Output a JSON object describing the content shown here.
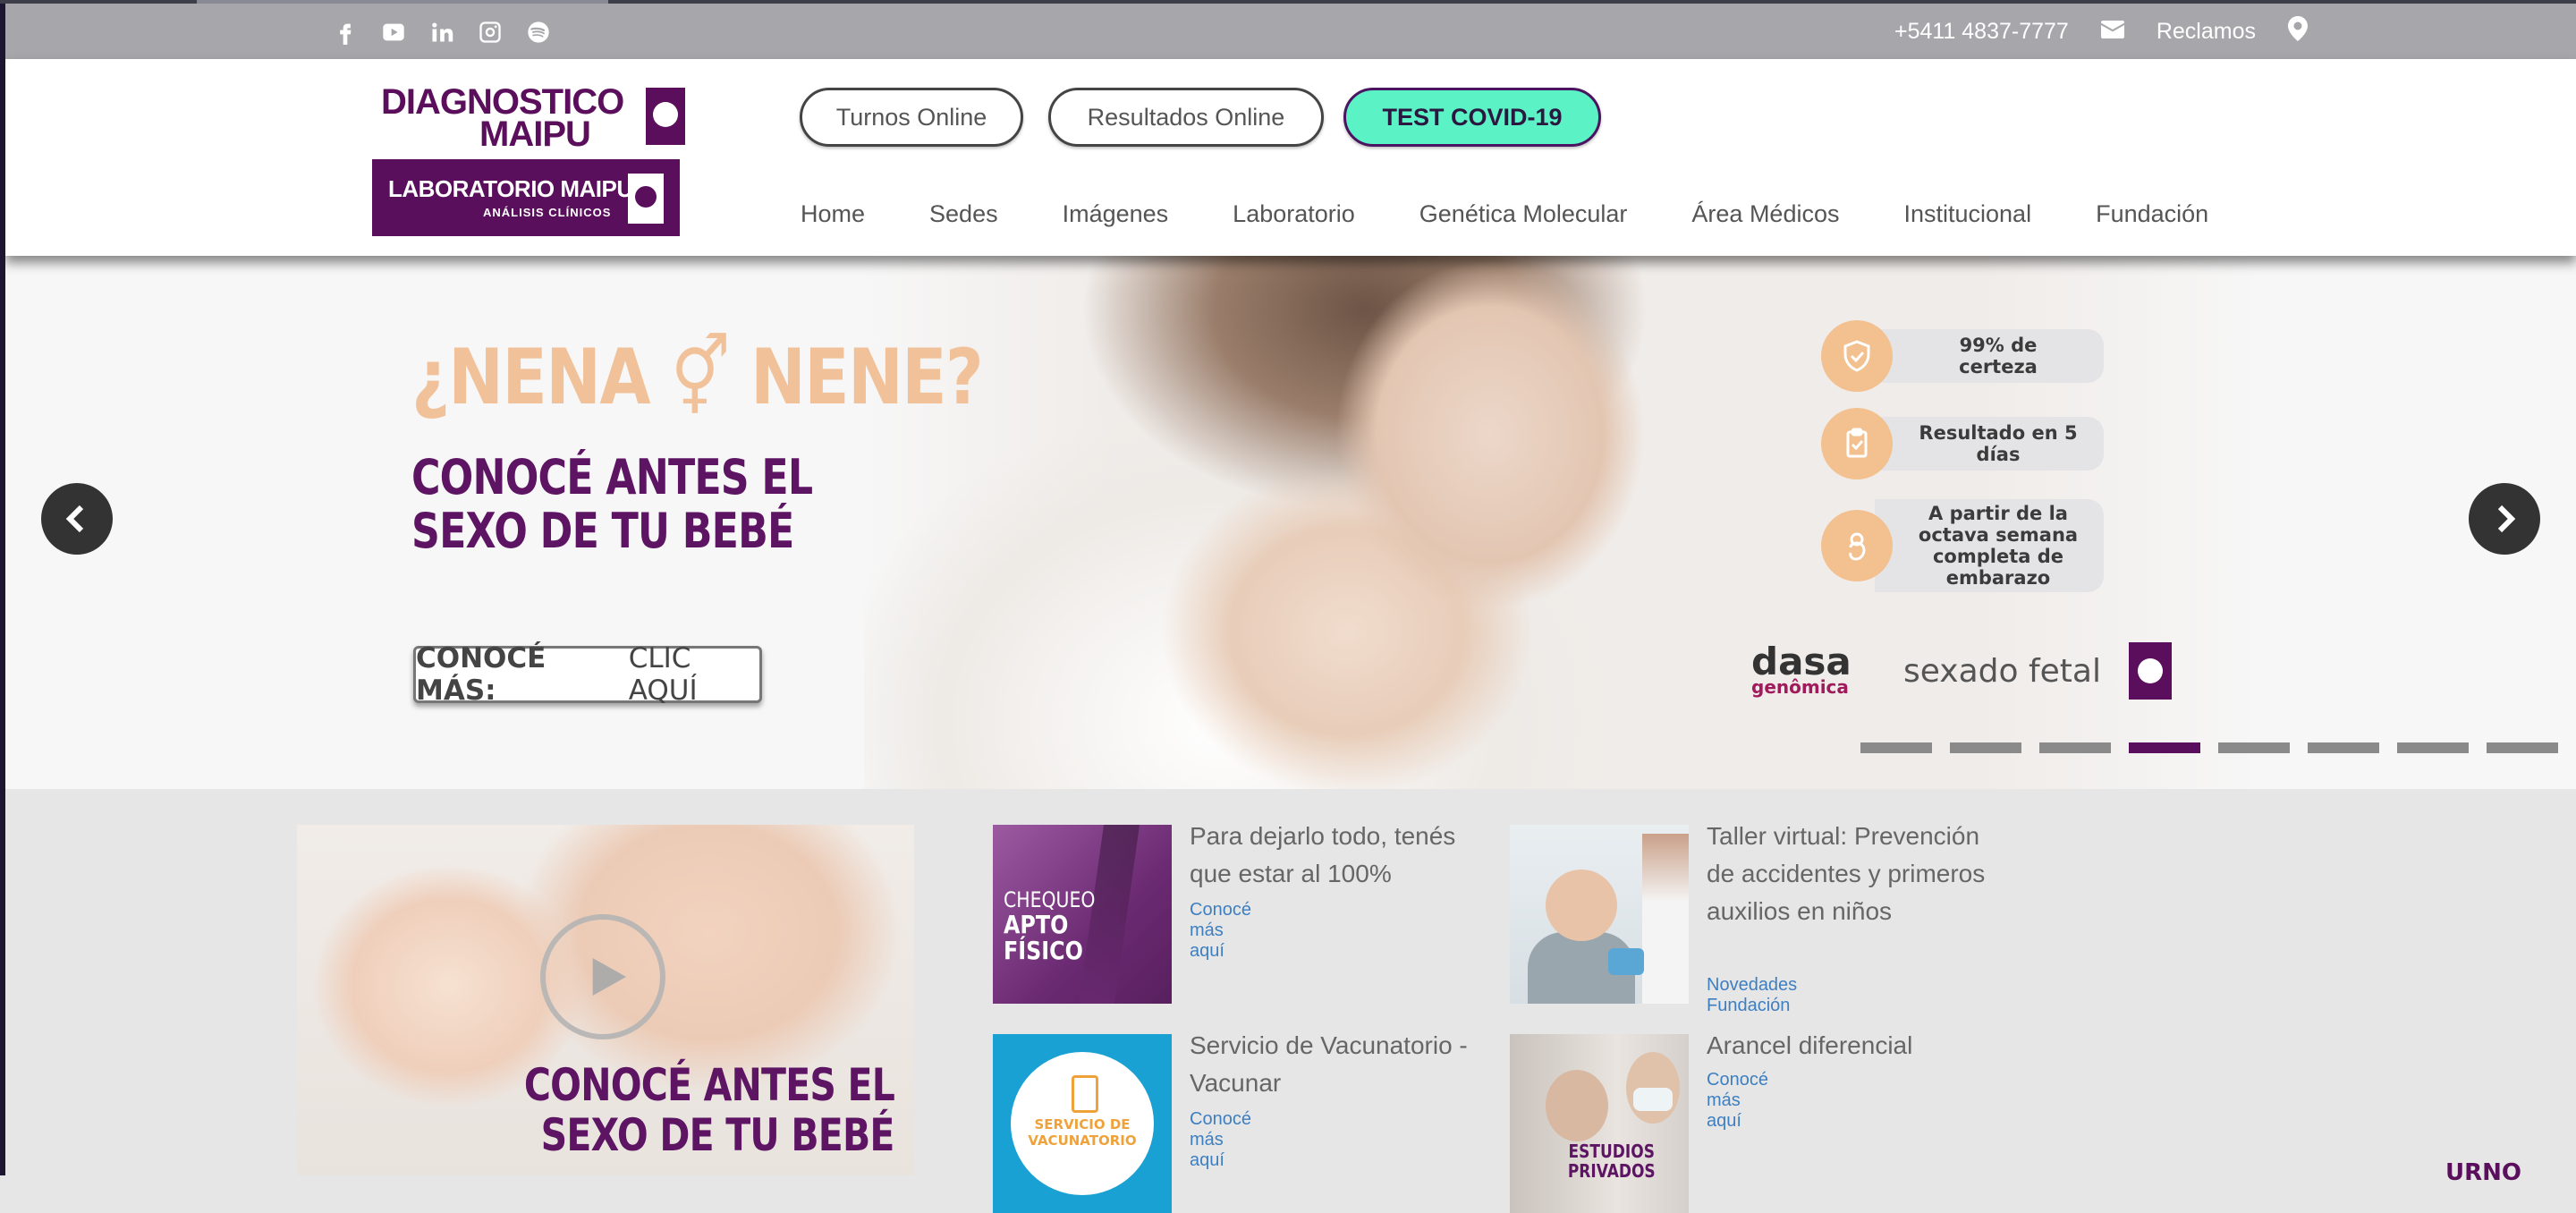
{
  "topbar": {
    "social_icons": [
      "facebook-icon",
      "youtube-icon",
      "linkedin-icon",
      "instagram-icon",
      "spotify-icon"
    ],
    "phone": "+5411 4837-7777",
    "reclamos": "Reclamos"
  },
  "header": {
    "logo_top_line1": "DIAGNOSTICO",
    "logo_top_line2": "MAIPU",
    "logo_bottom_line1": "LABORATORIO MAIPU",
    "logo_bottom_line2": "ANÁLISIS CLÍNICOS",
    "buttons": {
      "turnos": "Turnos Online",
      "resultados": "Resultados Online",
      "covid": "TEST COVID-19"
    },
    "nav": [
      "Home",
      "Sedes",
      "Imágenes",
      "Laboratorio",
      "Genética Molecular",
      "Área Médicos",
      "Institucional",
      "Fundación"
    ]
  },
  "hero": {
    "title": "¿NENA ⚥ NENE?",
    "subtitle_line1": "CONOCÉ ANTES EL",
    "subtitle_line2": "SEXO DE TU BEBÉ",
    "cta_bold": "CONOCÉ MÁS:",
    "cta_rest": "CLIC AQUÍ",
    "features": [
      "99% de certeza",
      "Resultado en 5 días",
      "A partir de la octava semana completa de embarazo"
    ],
    "brand_dasa": "dasa",
    "brand_dasa_sub": "genômica",
    "brand_sexado": "sexado fetal",
    "slide_count": 8,
    "active_slide": 4,
    "colors": {
      "accent_purple": "#5a0f5d",
      "peach": "#f1c29a",
      "covid_green": "#5bf2c5"
    }
  },
  "video": {
    "line1": "CONOCÉ ANTES EL",
    "line2": "SEXO DE TU BEBÉ"
  },
  "cards": [
    {
      "title": "Para dejarlo todo, tenés que estar al 100%",
      "link": "Conocé más aquí",
      "thumb_line1": "CHEQUEO",
      "thumb_line2": "APTO FÍSICO"
    },
    {
      "title": "Taller virtual: Prevención de accidentes y primeros auxilios en niños",
      "link": "Novedades Fundación"
    },
    {
      "title": "Servicio de Vacunatorio - Vacunar",
      "link": "Conocé más aquí",
      "thumb_line1": "SERVICIO DE VACUNATORIO"
    },
    {
      "title": "Arancel diferencial",
      "link": "Conocé más aquí",
      "thumb_line1": "ESTUDIOS PRIVADOS"
    }
  ],
  "corner_badge": "URNO"
}
